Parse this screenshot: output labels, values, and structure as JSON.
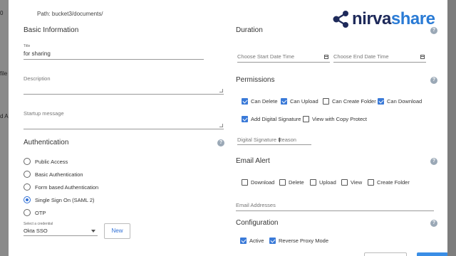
{
  "background": {
    "frag1": "0",
    "frag2": "file",
    "frag3": "d A"
  },
  "path": "Path:  bucket3/documents/",
  "logo": {
    "prefix": "nirva",
    "suffix": "share",
    "brand_color": "#1e2a5a",
    "accent_color": "#2a7bd5"
  },
  "basic_info": {
    "title": "Basic Information",
    "title_field": {
      "label": "Title",
      "value": "for sharing"
    },
    "description": {
      "placeholder": "Description"
    },
    "startup": {
      "placeholder": "Startup message"
    }
  },
  "authentication": {
    "title": "Authentication",
    "options": [
      {
        "label": "Public Access",
        "selected": false
      },
      {
        "label": "Basic Authentication",
        "selected": false
      },
      {
        "label": "Form based Authentication",
        "selected": false
      },
      {
        "label": "Single Sign On (SAML 2)",
        "selected": true
      },
      {
        "label": "OTP",
        "selected": false
      }
    ],
    "credential": {
      "label": "Select a credential",
      "value": "Okta SSO"
    },
    "new_button": "New"
  },
  "duration": {
    "title": "Duration",
    "start_placeholder": "Choose Start Date Time",
    "end_placeholder": "Choose End Date Time"
  },
  "permissions": {
    "title": "Permissions",
    "items": [
      {
        "label": "Can Delete",
        "checked": true
      },
      {
        "label": "Can Upload",
        "checked": true
      },
      {
        "label": "Can Create Folder",
        "checked": false
      },
      {
        "label": "Can Download",
        "checked": true
      },
      {
        "label": "Add Digital Signature",
        "checked": true
      },
      {
        "label": "View with Copy Protect",
        "checked": false
      }
    ],
    "signature_reason_placeholder": "Digital Signature Reason"
  },
  "email_alert": {
    "title": "Email Alert",
    "items": [
      {
        "label": "Download",
        "checked": false
      },
      {
        "label": "Delete",
        "checked": false
      },
      {
        "label": "Upload",
        "checked": false
      },
      {
        "label": "View",
        "checked": false
      },
      {
        "label": "Create Folder",
        "checked": false
      }
    ],
    "addresses_placeholder": "Email Addresses"
  },
  "configuration": {
    "title": "Configuration",
    "items": [
      {
        "label": "Active",
        "checked": true
      },
      {
        "label": "Reverse Proxy Mode",
        "checked": true
      }
    ]
  },
  "help_icon": "?",
  "icons": {
    "help": "help-circle-icon",
    "calendar": "calendar-icon",
    "cursor": "text-cursor-icon",
    "share": "share-nodes-icon"
  }
}
